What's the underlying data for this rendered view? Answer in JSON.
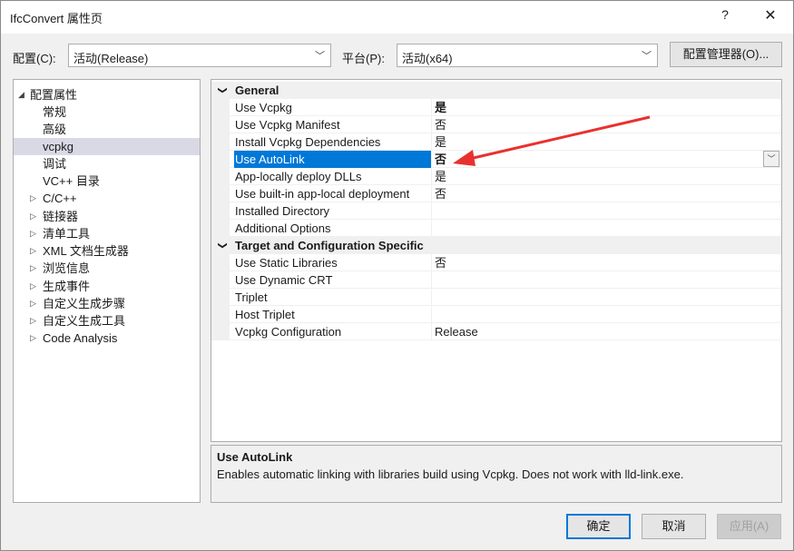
{
  "window": {
    "title": "IfcConvert 属性页",
    "help": "?",
    "close": "✕"
  },
  "toolbar": {
    "config_label": "配置(C):",
    "config_value": "活动(Release)",
    "platform_label": "平台(P):",
    "platform_value": "活动(x64)",
    "manager_button": "配置管理器(O)..."
  },
  "tree": {
    "items": [
      {
        "label": "配置属性",
        "toggle": "◢"
      },
      {
        "label": "常规"
      },
      {
        "label": "高级"
      },
      {
        "label": "vcpkg"
      },
      {
        "label": "调试"
      },
      {
        "label": "VC++ 目录"
      },
      {
        "label": "C/C++",
        "toggle": "▷"
      },
      {
        "label": "链接器",
        "toggle": "▷"
      },
      {
        "label": "清单工具",
        "toggle": "▷"
      },
      {
        "label": "XML 文档生成器",
        "toggle": "▷"
      },
      {
        "label": "浏览信息",
        "toggle": "▷"
      },
      {
        "label": "生成事件",
        "toggle": "▷"
      },
      {
        "label": "自定义生成步骤",
        "toggle": "▷"
      },
      {
        "label": "自定义生成工具",
        "toggle": "▷"
      },
      {
        "label": "Code Analysis",
        "toggle": "▷"
      }
    ]
  },
  "grid": {
    "categories": [
      {
        "name": "General",
        "chevron": "❯",
        "rows": [
          {
            "name": "Use Vcpkg",
            "value": "是"
          },
          {
            "name": "Use Vcpkg Manifest",
            "value": "否"
          },
          {
            "name": "Install Vcpkg Dependencies",
            "value": "是"
          },
          {
            "name": "Use AutoLink",
            "value": "否"
          },
          {
            "name": "App-locally deploy DLLs",
            "value": "是"
          },
          {
            "name": "Use built-in app-local deployment",
            "value": "否"
          },
          {
            "name": "Installed Directory",
            "value": ""
          },
          {
            "name": "Additional Options",
            "value": ""
          }
        ]
      },
      {
        "name": "Target and Configuration Specific",
        "chevron": "❯",
        "rows": [
          {
            "name": "Use Static Libraries",
            "value": "否"
          },
          {
            "name": "Use Dynamic CRT",
            "value": ""
          },
          {
            "name": "Triplet",
            "value": ""
          },
          {
            "name": "Host Triplet",
            "value": ""
          },
          {
            "name": "Vcpkg Configuration",
            "value": "Release"
          }
        ]
      }
    ],
    "dropdown_glyph": "﹀"
  },
  "description": {
    "title": "Use AutoLink",
    "text": "Enables automatic linking with libraries build using Vcpkg. Does not work with lld-link.exe."
  },
  "buttons": {
    "ok": "确定",
    "cancel": "取消",
    "apply": "应用(A)"
  },
  "colors": {
    "selection": "#0078d7",
    "annotation_arrow": "#e8312f"
  }
}
